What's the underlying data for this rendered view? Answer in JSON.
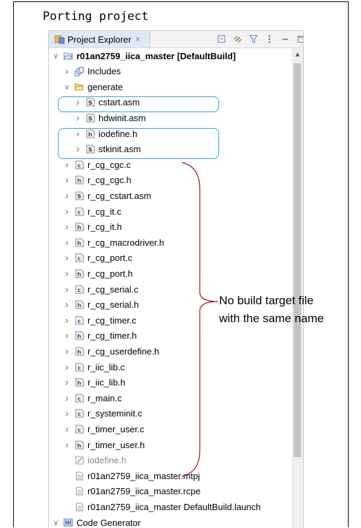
{
  "caption": "Porting project",
  "panel": {
    "tab_label": "Project Explorer",
    "tab_close": "×",
    "toolbar": [
      {
        "name": "collapse-all-icon"
      },
      {
        "name": "link-with-editor-icon"
      },
      {
        "name": "filter-icon"
      },
      {
        "name": "view-menu-icon"
      },
      {
        "name": "minimize-icon"
      },
      {
        "name": "maximize-icon"
      }
    ]
  },
  "tree": [
    {
      "label": "r01an2759_iica_master [DefaultBuild]",
      "icon": "project",
      "twisty": "open",
      "bold": true,
      "muted": false
    },
    {
      "label": "Includes",
      "icon": "includes",
      "twisty": "closed",
      "bold": false,
      "muted": false
    },
    {
      "label": "generate",
      "icon": "folder",
      "twisty": "open",
      "bold": false,
      "muted": false
    },
    {
      "label": "cstart.asm",
      "icon": "s",
      "twisty": "closed",
      "bold": false,
      "muted": false
    },
    {
      "label": "hdwinit.asm",
      "icon": "s",
      "twisty": "closed",
      "bold": false,
      "muted": false
    },
    {
      "label": "iodefine.h",
      "icon": "h",
      "twisty": "closed",
      "bold": false,
      "muted": false
    },
    {
      "label": "stkinit.asm",
      "icon": "s",
      "twisty": "closed",
      "bold": false,
      "muted": false
    },
    {
      "label": "r_cg_cgc.c",
      "icon": "c",
      "twisty": "closed",
      "bold": false,
      "muted": false
    },
    {
      "label": "r_cg_cgc.h",
      "icon": "h",
      "twisty": "closed",
      "bold": false,
      "muted": false
    },
    {
      "label": "r_cg_cstart.asm",
      "icon": "s",
      "twisty": "closed",
      "bold": false,
      "muted": false
    },
    {
      "label": "r_cg_it.c",
      "icon": "c",
      "twisty": "closed",
      "bold": false,
      "muted": false
    },
    {
      "label": "r_cg_it.h",
      "icon": "h",
      "twisty": "closed",
      "bold": false,
      "muted": false
    },
    {
      "label": "r_cg_macrodriver.h",
      "icon": "h",
      "twisty": "closed",
      "bold": false,
      "muted": false
    },
    {
      "label": "r_cg_port.c",
      "icon": "c",
      "twisty": "closed",
      "bold": false,
      "muted": false
    },
    {
      "label": "r_cg_port.h",
      "icon": "h",
      "twisty": "closed",
      "bold": false,
      "muted": false
    },
    {
      "label": "r_cg_serial.c",
      "icon": "c",
      "twisty": "closed",
      "bold": false,
      "muted": false
    },
    {
      "label": "r_cg_serial.h",
      "icon": "h",
      "twisty": "closed",
      "bold": false,
      "muted": false
    },
    {
      "label": "r_cg_timer.c",
      "icon": "c",
      "twisty": "closed",
      "bold": false,
      "muted": false
    },
    {
      "label": "r_cg_timer.h",
      "icon": "h",
      "twisty": "closed",
      "bold": false,
      "muted": false
    },
    {
      "label": "r_cg_userdefine.h",
      "icon": "h",
      "twisty": "closed",
      "bold": false,
      "muted": false
    },
    {
      "label": "r_iic_lib.c",
      "icon": "c",
      "twisty": "closed",
      "bold": false,
      "muted": false
    },
    {
      "label": "r_iic_lib.h",
      "icon": "h",
      "twisty": "closed",
      "bold": false,
      "muted": false
    },
    {
      "label": "r_main.c",
      "icon": "c",
      "twisty": "closed",
      "bold": false,
      "muted": false
    },
    {
      "label": "r_systeminit.c",
      "icon": "c",
      "twisty": "closed",
      "bold": false,
      "muted": false
    },
    {
      "label": "r_timer_user.c",
      "icon": "c",
      "twisty": "closed",
      "bold": false,
      "muted": false
    },
    {
      "label": "r_timer_user.h",
      "icon": "h",
      "twisty": "closed",
      "bold": false,
      "muted": false
    },
    {
      "label": "iodefine.h",
      "icon": "excluded",
      "twisty": "none",
      "bold": false,
      "muted": true
    },
    {
      "label": "r01an2759_iica_master.mtpj",
      "icon": "file",
      "twisty": "none",
      "bold": false,
      "muted": false
    },
    {
      "label": "r01an2759_iica_master.rcpe",
      "icon": "file",
      "twisty": "none",
      "bold": false,
      "muted": false
    },
    {
      "label": "r01an2759_iica_master DefaultBuild.launch",
      "icon": "file",
      "twisty": "none",
      "bold": false,
      "muted": false
    },
    {
      "label": "Code Generator",
      "icon": "codegen",
      "twisty": "open",
      "bold": false,
      "muted": false
    }
  ],
  "annotation": {
    "line1": "No build target file",
    "line2": "with the same name"
  },
  "colors": {
    "highlight": "#29a7d8",
    "brace": "#a01010",
    "tab_active": "#dde8f8"
  }
}
